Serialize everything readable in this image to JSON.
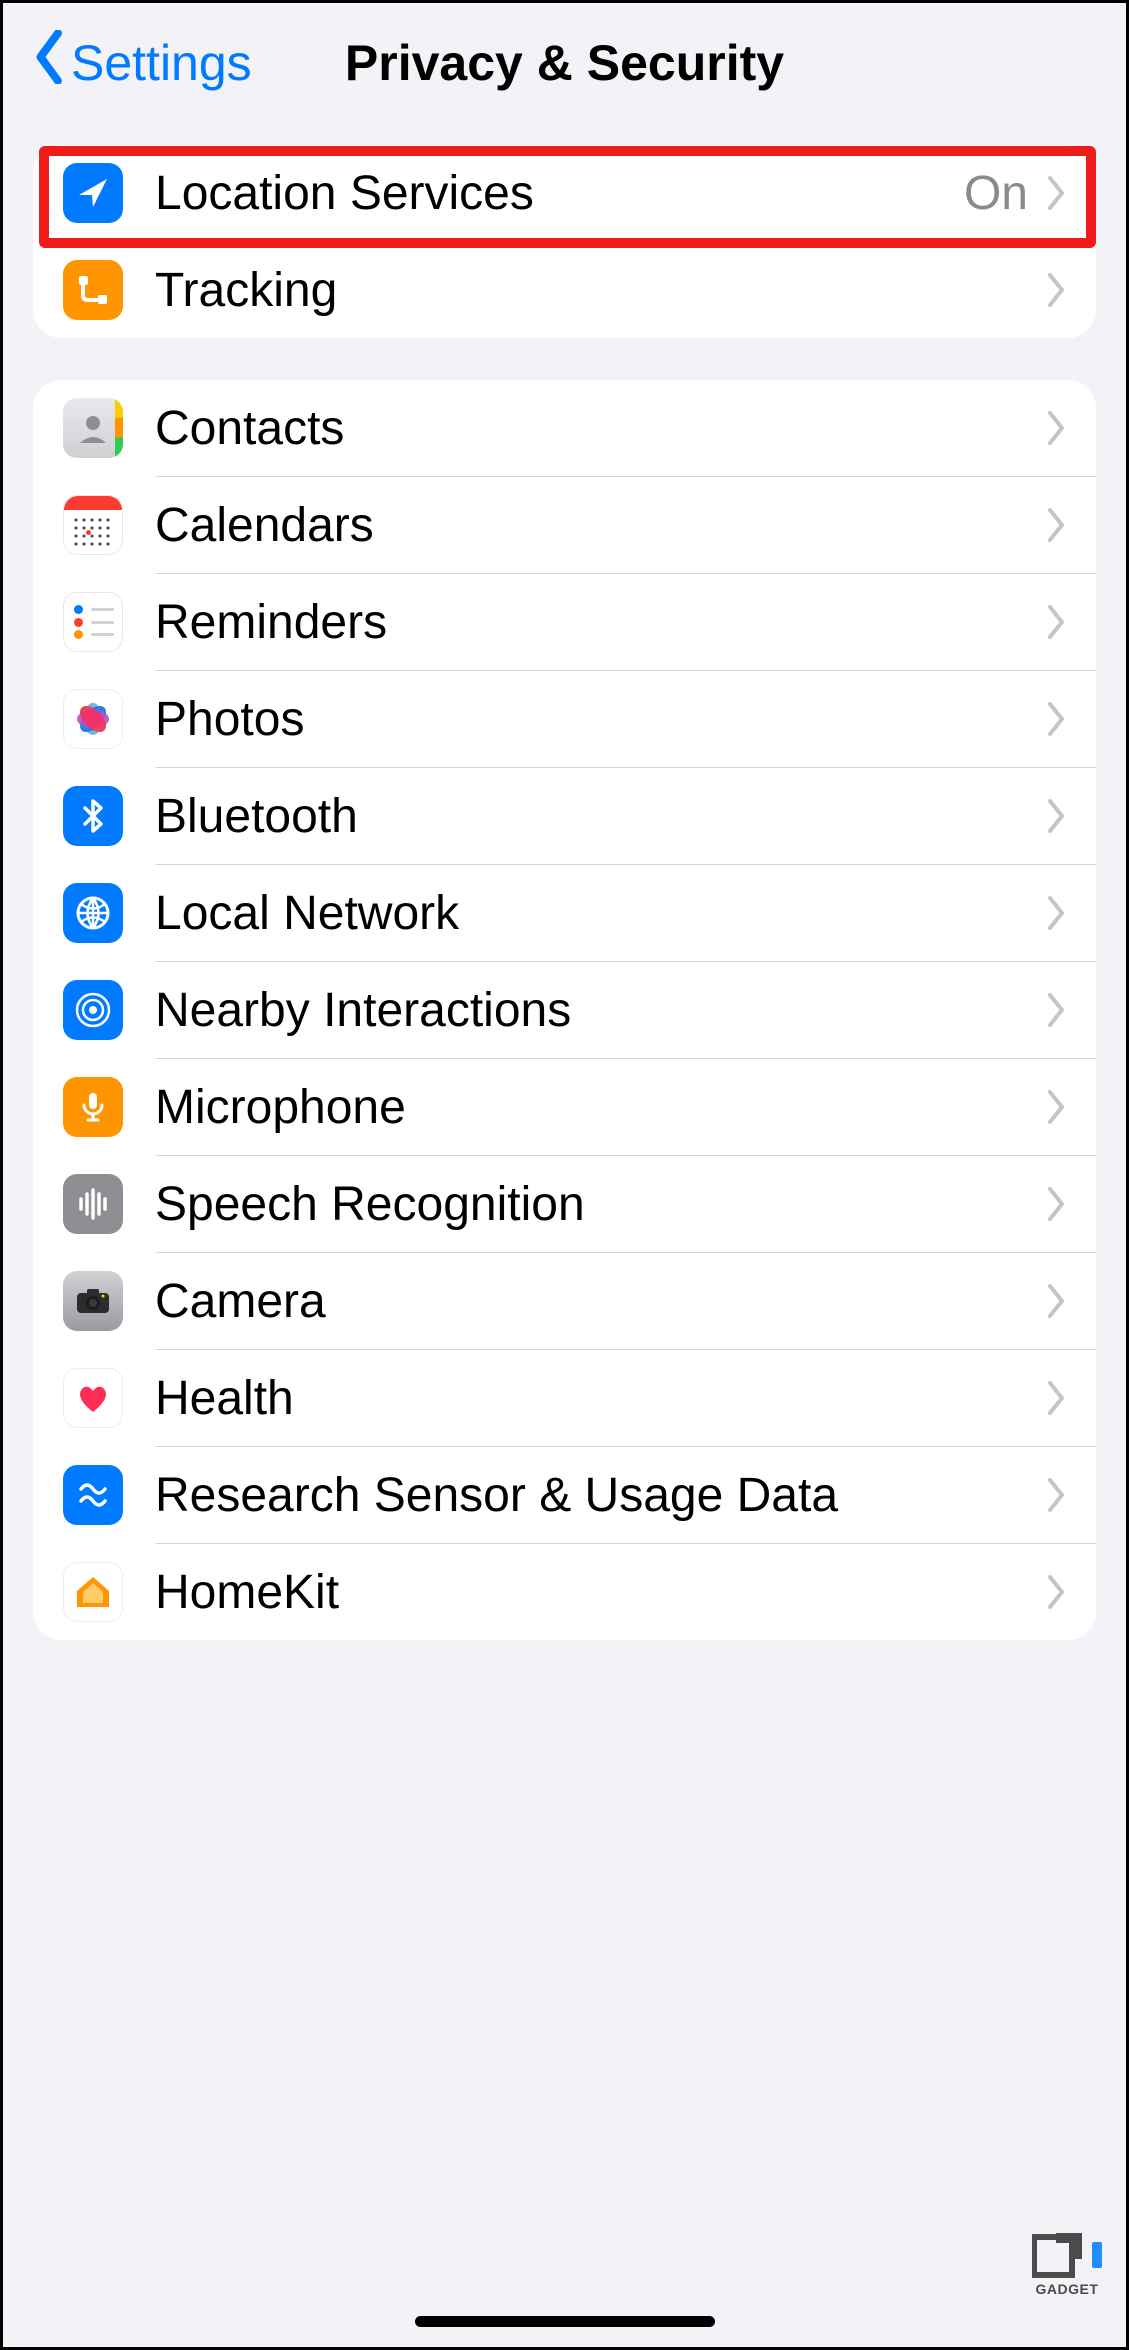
{
  "nav": {
    "back_label": "Settings",
    "title": "Privacy & Security"
  },
  "group1": [
    {
      "id": "location-services",
      "label": "Location Services",
      "value": "On",
      "icon": "location-arrow-icon",
      "bg": "bg-blue",
      "highlighted": true
    },
    {
      "id": "tracking",
      "label": "Tracking",
      "value": "",
      "icon": "tracking-icon",
      "bg": "bg-orange"
    }
  ],
  "group2": [
    {
      "id": "contacts",
      "label": "Contacts",
      "icon": "contacts-icon"
    },
    {
      "id": "calendars",
      "label": "Calendars",
      "icon": "calendar-icon"
    },
    {
      "id": "reminders",
      "label": "Reminders",
      "icon": "reminders-icon"
    },
    {
      "id": "photos",
      "label": "Photos",
      "icon": "photos-icon"
    },
    {
      "id": "bluetooth",
      "label": "Bluetooth",
      "icon": "bluetooth-icon",
      "bg": "bg-blue"
    },
    {
      "id": "local-network",
      "label": "Local Network",
      "icon": "globe-icon",
      "bg": "bg-blue"
    },
    {
      "id": "nearby-interactions",
      "label": "Nearby Interactions",
      "icon": "nearby-icon",
      "bg": "bg-blue"
    },
    {
      "id": "microphone",
      "label": "Microphone",
      "icon": "microphone-icon",
      "bg": "bg-orange"
    },
    {
      "id": "speech-recognition",
      "label": "Speech Recognition",
      "icon": "waveform-icon",
      "bg": "bg-gray"
    },
    {
      "id": "camera",
      "label": "Camera",
      "icon": "camera-icon",
      "bg": "bg-grad-gray"
    },
    {
      "id": "health",
      "label": "Health",
      "icon": "heart-icon"
    },
    {
      "id": "research",
      "label": "Research Sensor & Usage Data",
      "icon": "research-icon",
      "bg": "bg-blue"
    },
    {
      "id": "homekit",
      "label": "HomeKit",
      "icon": "home-icon"
    }
  ],
  "watermark": {
    "text": "GADGET"
  }
}
